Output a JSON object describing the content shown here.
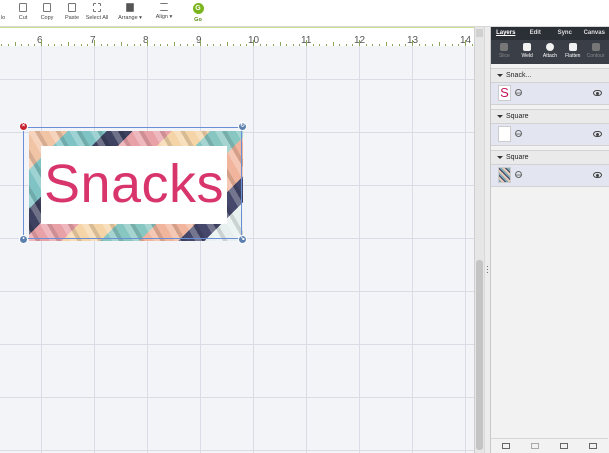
{
  "toolbar": {
    "items": [
      {
        "label": "lo"
      },
      {
        "label": "Cut"
      },
      {
        "label": "Copy"
      },
      {
        "label": "Paste"
      },
      {
        "label": "Select All"
      },
      {
        "label": "Arrange ▾"
      },
      {
        "label": "Align ▾"
      }
    ],
    "go": {
      "icon_letter": "G",
      "label": "Go"
    }
  },
  "ruler": {
    "labels": [
      "6",
      "7",
      "8",
      "9",
      "10",
      "11",
      "12",
      "13",
      "14"
    ]
  },
  "canvas": {
    "text_object": {
      "text": "Snacks",
      "color": "#d8356c"
    }
  },
  "panel": {
    "tabs": [
      "Layers",
      "Edit",
      "Sync",
      "Canvas"
    ],
    "tools": [
      {
        "label": "Slice",
        "enabled": false
      },
      {
        "label": "Weld",
        "enabled": true
      },
      {
        "label": "Attach",
        "enabled": true
      },
      {
        "label": "Flatten",
        "enabled": true
      },
      {
        "label": "Contour",
        "enabled": false
      }
    ],
    "groups": [
      {
        "name": "Snack...",
        "thumb_letter": "S"
      },
      {
        "name": "Square",
        "thumb_letter": ""
      },
      {
        "name": "Square",
        "thumb_letter": ""
      }
    ]
  },
  "colors": {
    "accent_green": "#7ab51d",
    "panel_dark": "#2b2f36",
    "text_pink": "#d8356c"
  }
}
